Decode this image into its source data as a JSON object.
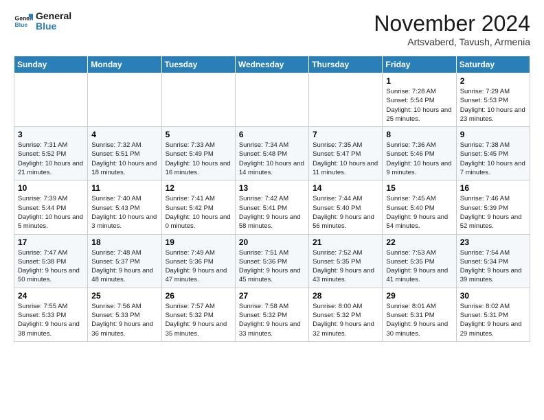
{
  "logo": {
    "line1": "General",
    "line2": "Blue"
  },
  "header": {
    "month": "November 2024",
    "location": "Artsvaberd, Tavush, Armenia"
  },
  "weekdays": [
    "Sunday",
    "Monday",
    "Tuesday",
    "Wednesday",
    "Thursday",
    "Friday",
    "Saturday"
  ],
  "weeks": [
    [
      {
        "day": "",
        "info": ""
      },
      {
        "day": "",
        "info": ""
      },
      {
        "day": "",
        "info": ""
      },
      {
        "day": "",
        "info": ""
      },
      {
        "day": "",
        "info": ""
      },
      {
        "day": "1",
        "info": "Sunrise: 7:28 AM\nSunset: 5:54 PM\nDaylight: 10 hours and 25 minutes."
      },
      {
        "day": "2",
        "info": "Sunrise: 7:29 AM\nSunset: 5:53 PM\nDaylight: 10 hours and 23 minutes."
      }
    ],
    [
      {
        "day": "3",
        "info": "Sunrise: 7:31 AM\nSunset: 5:52 PM\nDaylight: 10 hours and 21 minutes."
      },
      {
        "day": "4",
        "info": "Sunrise: 7:32 AM\nSunset: 5:51 PM\nDaylight: 10 hours and 18 minutes."
      },
      {
        "day": "5",
        "info": "Sunrise: 7:33 AM\nSunset: 5:49 PM\nDaylight: 10 hours and 16 minutes."
      },
      {
        "day": "6",
        "info": "Sunrise: 7:34 AM\nSunset: 5:48 PM\nDaylight: 10 hours and 14 minutes."
      },
      {
        "day": "7",
        "info": "Sunrise: 7:35 AM\nSunset: 5:47 PM\nDaylight: 10 hours and 11 minutes."
      },
      {
        "day": "8",
        "info": "Sunrise: 7:36 AM\nSunset: 5:46 PM\nDaylight: 10 hours and 9 minutes."
      },
      {
        "day": "9",
        "info": "Sunrise: 7:38 AM\nSunset: 5:45 PM\nDaylight: 10 hours and 7 minutes."
      }
    ],
    [
      {
        "day": "10",
        "info": "Sunrise: 7:39 AM\nSunset: 5:44 PM\nDaylight: 10 hours and 5 minutes."
      },
      {
        "day": "11",
        "info": "Sunrise: 7:40 AM\nSunset: 5:43 PM\nDaylight: 10 hours and 3 minutes."
      },
      {
        "day": "12",
        "info": "Sunrise: 7:41 AM\nSunset: 5:42 PM\nDaylight: 10 hours and 0 minutes."
      },
      {
        "day": "13",
        "info": "Sunrise: 7:42 AM\nSunset: 5:41 PM\nDaylight: 9 hours and 58 minutes."
      },
      {
        "day": "14",
        "info": "Sunrise: 7:44 AM\nSunset: 5:40 PM\nDaylight: 9 hours and 56 minutes."
      },
      {
        "day": "15",
        "info": "Sunrise: 7:45 AM\nSunset: 5:40 PM\nDaylight: 9 hours and 54 minutes."
      },
      {
        "day": "16",
        "info": "Sunrise: 7:46 AM\nSunset: 5:39 PM\nDaylight: 9 hours and 52 minutes."
      }
    ],
    [
      {
        "day": "17",
        "info": "Sunrise: 7:47 AM\nSunset: 5:38 PM\nDaylight: 9 hours and 50 minutes."
      },
      {
        "day": "18",
        "info": "Sunrise: 7:48 AM\nSunset: 5:37 PM\nDaylight: 9 hours and 48 minutes."
      },
      {
        "day": "19",
        "info": "Sunrise: 7:49 AM\nSunset: 5:36 PM\nDaylight: 9 hours and 47 minutes."
      },
      {
        "day": "20",
        "info": "Sunrise: 7:51 AM\nSunset: 5:36 PM\nDaylight: 9 hours and 45 minutes."
      },
      {
        "day": "21",
        "info": "Sunrise: 7:52 AM\nSunset: 5:35 PM\nDaylight: 9 hours and 43 minutes."
      },
      {
        "day": "22",
        "info": "Sunrise: 7:53 AM\nSunset: 5:35 PM\nDaylight: 9 hours and 41 minutes."
      },
      {
        "day": "23",
        "info": "Sunrise: 7:54 AM\nSunset: 5:34 PM\nDaylight: 9 hours and 39 minutes."
      }
    ],
    [
      {
        "day": "24",
        "info": "Sunrise: 7:55 AM\nSunset: 5:33 PM\nDaylight: 9 hours and 38 minutes."
      },
      {
        "day": "25",
        "info": "Sunrise: 7:56 AM\nSunset: 5:33 PM\nDaylight: 9 hours and 36 minutes."
      },
      {
        "day": "26",
        "info": "Sunrise: 7:57 AM\nSunset: 5:32 PM\nDaylight: 9 hours and 35 minutes."
      },
      {
        "day": "27",
        "info": "Sunrise: 7:58 AM\nSunset: 5:32 PM\nDaylight: 9 hours and 33 minutes."
      },
      {
        "day": "28",
        "info": "Sunrise: 8:00 AM\nSunset: 5:32 PM\nDaylight: 9 hours and 32 minutes."
      },
      {
        "day": "29",
        "info": "Sunrise: 8:01 AM\nSunset: 5:31 PM\nDaylight: 9 hours and 30 minutes."
      },
      {
        "day": "30",
        "info": "Sunrise: 8:02 AM\nSunset: 5:31 PM\nDaylight: 9 hours and 29 minutes."
      }
    ]
  ]
}
